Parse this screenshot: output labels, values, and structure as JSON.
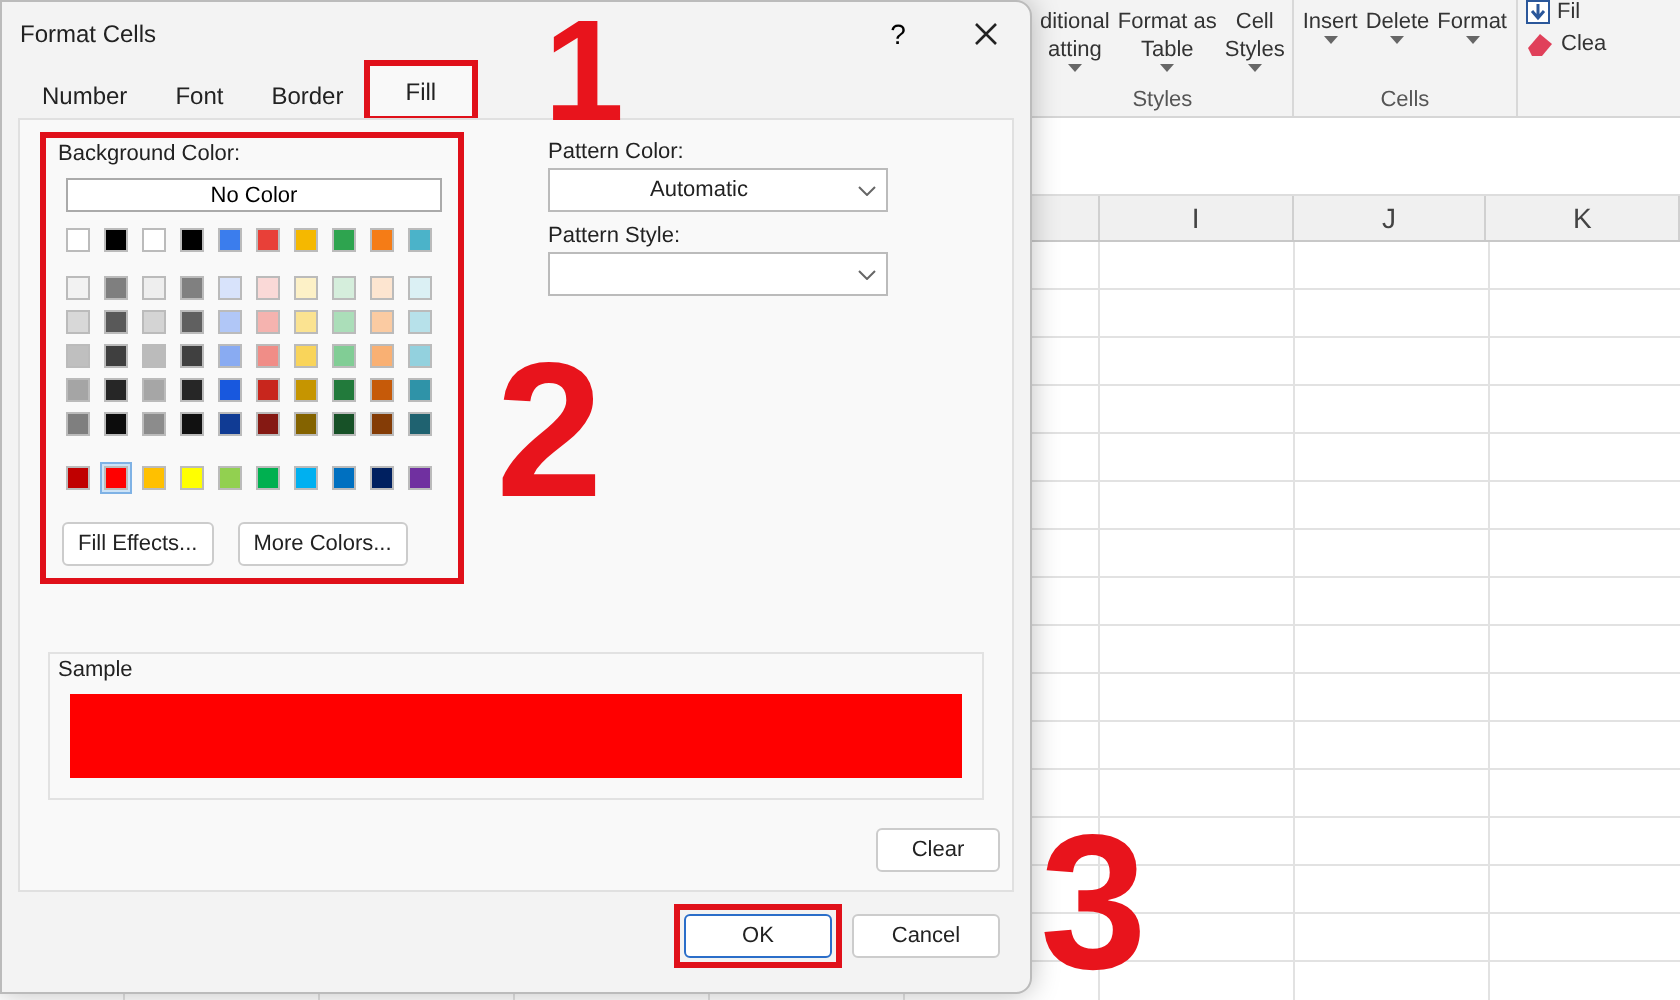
{
  "ribbon": {
    "groups": [
      {
        "label": "Styles",
        "buttons": [
          {
            "lines": [
              "ditional",
              "atting"
            ],
            "caret": true
          },
          {
            "lines": [
              "Format as",
              "Table"
            ],
            "caret": true
          },
          {
            "lines": [
              "Cell",
              "Styles"
            ],
            "caret": true
          }
        ]
      },
      {
        "label": "Cells",
        "buttons": [
          {
            "lines": [
              "Insert"
            ],
            "caret": true
          },
          {
            "lines": [
              "Delete"
            ],
            "caret": true
          },
          {
            "lines": [
              "Format"
            ],
            "caret": true
          }
        ]
      }
    ],
    "editing": [
      {
        "label": "Fil",
        "kind": "fill"
      },
      {
        "label": "Clea",
        "kind": "clear"
      }
    ]
  },
  "sheet": {
    "columns": [
      "I",
      "J",
      "K"
    ]
  },
  "dialog": {
    "title": "Format Cells",
    "help": "?",
    "tabs": [
      {
        "label": "Number",
        "selected": false,
        "highlighted": false
      },
      {
        "label": "Font",
        "selected": false,
        "highlighted": false
      },
      {
        "label": "Border",
        "selected": false,
        "highlighted": false
      },
      {
        "label": "Fill",
        "selected": true,
        "highlighted": true
      }
    ],
    "background_color": {
      "label": "Background Color:",
      "no_color": "No Color",
      "highlighted": true,
      "theme_rows": [
        [
          {
            "color": "#ffffff",
            "selected": false
          },
          {
            "color": "#000000",
            "selected": false
          },
          {
            "color": "#ffffff",
            "selected": false
          },
          {
            "color": "#000000",
            "selected": false
          },
          {
            "color": "#3b7ded",
            "selected": false
          },
          {
            "color": "#e84038",
            "selected": false
          },
          {
            "color": "#f5b800",
            "selected": false
          },
          {
            "color": "#2ea44f",
            "selected": false
          },
          {
            "color": "#f57c16",
            "selected": false
          },
          {
            "color": "#4bb3c9",
            "selected": false
          }
        ],
        [
          {
            "color": "#f2f2f2",
            "selected": false
          },
          {
            "color": "#7f7f7f",
            "selected": false
          },
          {
            "color": "#eeeeee",
            "selected": false
          },
          {
            "color": "#808080",
            "selected": false
          },
          {
            "color": "#d8e3fb",
            "selected": false
          },
          {
            "color": "#fad9d7",
            "selected": false
          },
          {
            "color": "#fdf1c7",
            "selected": false
          },
          {
            "color": "#d5eedc",
            "selected": false
          },
          {
            "color": "#fde5d0",
            "selected": false
          },
          {
            "color": "#dbf0f4",
            "selected": false
          }
        ],
        [
          {
            "color": "#d8d8d8",
            "selected": false
          },
          {
            "color": "#595959",
            "selected": false
          },
          {
            "color": "#d4d4d4",
            "selected": false
          },
          {
            "color": "#606060",
            "selected": false
          },
          {
            "color": "#b1c7f7",
            "selected": false
          },
          {
            "color": "#f5b3af",
            "selected": false
          },
          {
            "color": "#fbe391",
            "selected": false
          },
          {
            "color": "#abdeb9",
            "selected": false
          },
          {
            "color": "#fbcba2",
            "selected": false
          },
          {
            "color": "#b7e1ea",
            "selected": false
          }
        ],
        [
          {
            "color": "#bfbfbf",
            "selected": false
          },
          {
            "color": "#3f3f3f",
            "selected": false
          },
          {
            "color": "#bbbbbb",
            "selected": false
          },
          {
            "color": "#404040",
            "selected": false
          },
          {
            "color": "#89abf2",
            "selected": false
          },
          {
            "color": "#f08d87",
            "selected": false
          },
          {
            "color": "#f9d45a",
            "selected": false
          },
          {
            "color": "#81cd95",
            "selected": false
          },
          {
            "color": "#f9b073",
            "selected": false
          },
          {
            "color": "#93d1de",
            "selected": false
          }
        ],
        [
          {
            "color": "#a5a5a5",
            "selected": false
          },
          {
            "color": "#262626",
            "selected": false
          },
          {
            "color": "#a6a6a6",
            "selected": false
          },
          {
            "color": "#262626",
            "selected": false
          },
          {
            "color": "#1858de",
            "selected": false
          },
          {
            "color": "#c8261d",
            "selected": false
          },
          {
            "color": "#c69500",
            "selected": false
          },
          {
            "color": "#227a3b",
            "selected": false
          },
          {
            "color": "#c65a09",
            "selected": false
          },
          {
            "color": "#2f93a8",
            "selected": false
          }
        ],
        [
          {
            "color": "#7f7f7f",
            "selected": false
          },
          {
            "color": "#0c0c0c",
            "selected": false
          },
          {
            "color": "#8c8c8c",
            "selected": false
          },
          {
            "color": "#111111",
            "selected": false
          },
          {
            "color": "#103b94",
            "selected": false
          },
          {
            "color": "#851913",
            "selected": false
          },
          {
            "color": "#846300",
            "selected": false
          },
          {
            "color": "#175127",
            "selected": false
          },
          {
            "color": "#843c06",
            "selected": false
          },
          {
            "color": "#1f6270",
            "selected": false
          }
        ]
      ],
      "standard_row": [
        {
          "color": "#c00000",
          "selected": false
        },
        {
          "color": "#ff0000",
          "selected": true
        },
        {
          "color": "#ffc000",
          "selected": false
        },
        {
          "color": "#ffff00",
          "selected": false
        },
        {
          "color": "#92d050",
          "selected": false
        },
        {
          "color": "#00b050",
          "selected": false
        },
        {
          "color": "#00b0f0",
          "selected": false
        },
        {
          "color": "#0070c0",
          "selected": false
        },
        {
          "color": "#002060",
          "selected": false
        },
        {
          "color": "#7030a0",
          "selected": false
        }
      ],
      "buttons": [
        "Fill Effects...",
        "More Colors..."
      ]
    },
    "pattern_color": {
      "label": "Pattern Color:",
      "value": "Automatic"
    },
    "pattern_style": {
      "label": "Pattern Style:"
    },
    "sample": {
      "label": "Sample",
      "color": "#ff0000"
    },
    "clear_button": "Clear",
    "buttons": [
      {
        "label": "OK",
        "highlighted": true
      },
      {
        "label": "Cancel",
        "highlighted": false
      }
    ]
  },
  "step_numbers": [
    "1",
    "2",
    "3"
  ]
}
